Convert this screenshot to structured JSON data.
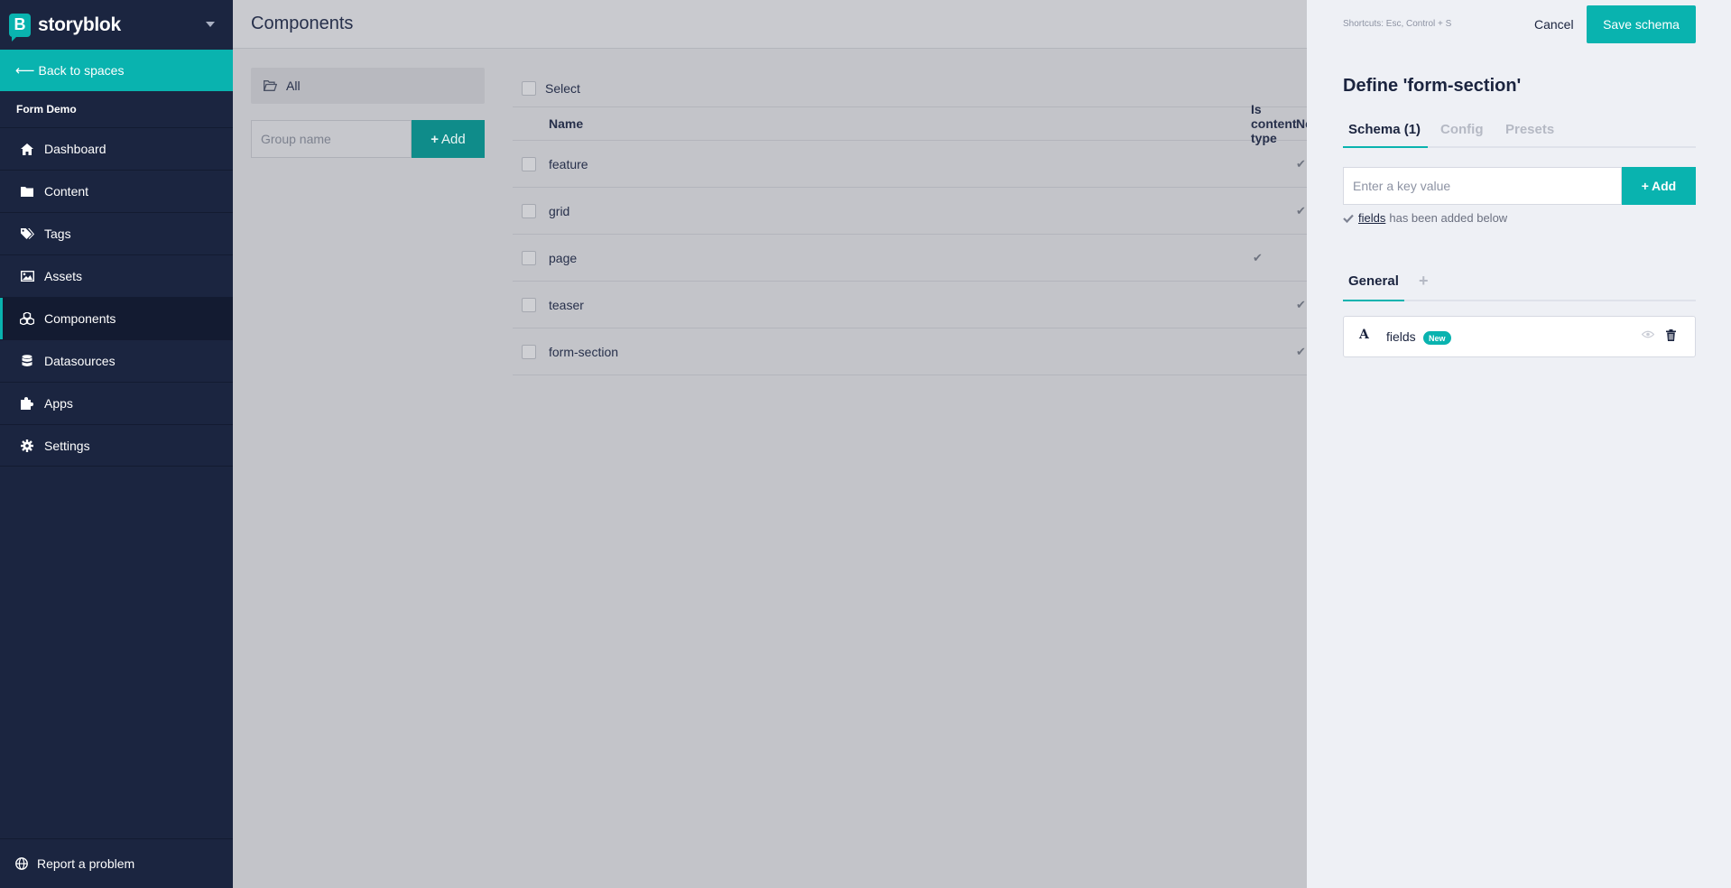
{
  "brand": {
    "name": "storyblok",
    "logo_letter": "B"
  },
  "sidebar": {
    "back_label": "Back to spaces",
    "space_name": "Form Demo",
    "items": [
      {
        "label": "Dashboard",
        "icon": "home-icon"
      },
      {
        "label": "Content",
        "icon": "folder-icon"
      },
      {
        "label": "Tags",
        "icon": "tags-icon"
      },
      {
        "label": "Assets",
        "icon": "image-icon"
      },
      {
        "label": "Components",
        "icon": "cubes-icon",
        "active": true
      },
      {
        "label": "Datasources",
        "icon": "database-icon"
      },
      {
        "label": "Apps",
        "icon": "puzzle-icon"
      },
      {
        "label": "Settings",
        "icon": "gear-icon"
      }
    ],
    "report_label": "Report a problem"
  },
  "main": {
    "title": "Components",
    "groups": {
      "all_label": "All",
      "group_placeholder": "Group name",
      "add_label": "Add"
    },
    "table": {
      "select_label": "Select",
      "columns": {
        "name": "Name",
        "content_type": "Is content type",
        "nestable": "Nestable"
      },
      "rows": [
        {
          "name": "feature",
          "content_type": "",
          "nestable": "✔"
        },
        {
          "name": "grid",
          "content_type": "",
          "nestable": "✔"
        },
        {
          "name": "page",
          "content_type": "✔",
          "nestable": ""
        },
        {
          "name": "teaser",
          "content_type": "",
          "nestable": "✔"
        },
        {
          "name": "form-section",
          "content_type": "",
          "nestable": "✔"
        }
      ]
    }
  },
  "panel": {
    "shortcuts": "Shortcuts: Esc, Control + S",
    "cancel_label": "Cancel",
    "save_label": "Save schema",
    "title": "Define 'form-section'",
    "tabs": {
      "schema": "Schema (1)",
      "config": "Config",
      "presets": "Presets"
    },
    "key_placeholder": "Enter a key value",
    "key_add_label": "Add",
    "added_field": "fields",
    "added_message": "has been added below",
    "general_tab": "General",
    "field": {
      "type_symbol": "A",
      "name": "fields",
      "badge": "New"
    }
  },
  "colors": {
    "accent": "#09b3af",
    "sidebar_bg": "#1b2540",
    "panel_bg": "#eef0f5"
  }
}
